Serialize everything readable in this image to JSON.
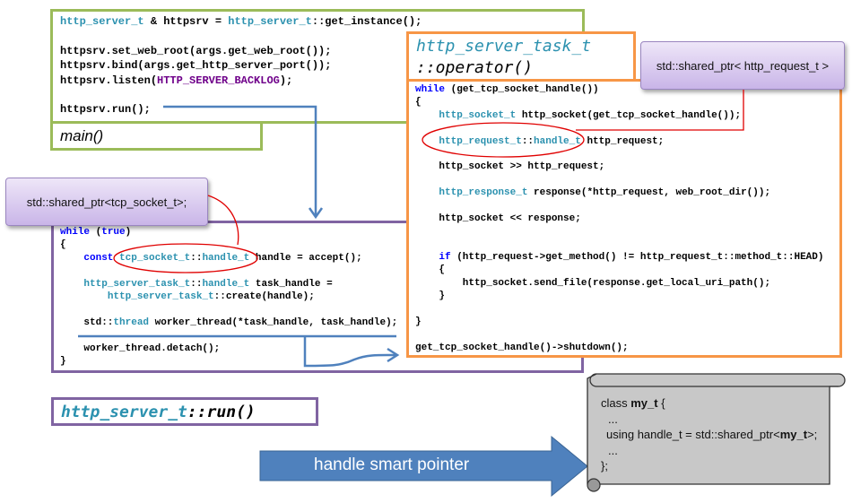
{
  "main_box": {
    "label": "main()",
    "lines": [
      [
        {
          "t": "http_server_t",
          "c": "ty"
        },
        {
          "t": " & httpsrv = "
        },
        {
          "t": "http_server_t",
          "c": "ty"
        },
        {
          "t": "::get_instance();"
        }
      ],
      [],
      [
        {
          "t": "httpsrv.set_web_root(args.get_web_root());"
        }
      ],
      [
        {
          "t": "httpsrv.bind(args.get_http_server_port());"
        }
      ],
      [
        {
          "t": "httpsrv.listen("
        },
        {
          "t": "HTTP_SERVER_BACKLOG",
          "c": "mc"
        },
        {
          "t": ");"
        }
      ],
      [],
      [
        {
          "t": "httpsrv.run();"
        }
      ]
    ]
  },
  "task_box": {
    "title_line1": "http_server_task_t",
    "title_line2": "::operator()",
    "lines": [
      [
        {
          "t": "while",
          "c": "kw"
        },
        {
          "t": " (get_tcp_socket_handle())"
        }
      ],
      [
        {
          "t": "{"
        }
      ],
      [
        {
          "t": "    "
        },
        {
          "t": "http_socket_t",
          "c": "ty"
        },
        {
          "t": " http_socket(get_tcp_socket_handle());"
        }
      ],
      [],
      [
        {
          "t": "    "
        },
        {
          "t": "http_request_t",
          "c": "ty"
        },
        {
          "t": "::"
        },
        {
          "t": "handle_t",
          "c": "ty"
        },
        {
          "t": " http_request;"
        }
      ],
      [],
      [
        {
          "t": "    http_socket >> http_request;"
        }
      ],
      [],
      [
        {
          "t": "    "
        },
        {
          "t": "http_response_t",
          "c": "ty"
        },
        {
          "t": " response(*http_request, web_root_dir());"
        }
      ],
      [],
      [
        {
          "t": "    http_socket << response;"
        }
      ],
      [],
      [],
      [
        {
          "t": "    "
        },
        {
          "t": "if",
          "c": "kw"
        },
        {
          "t": " (http_request->get_method() != http_request_t::method_t::HEAD)"
        }
      ],
      [
        {
          "t": "    {"
        }
      ],
      [
        {
          "t": "        http_socket.send_file(response.get_local_uri_path();"
        }
      ],
      [
        {
          "t": "    }"
        }
      ],
      [],
      [
        {
          "t": "}"
        }
      ],
      [],
      [
        {
          "t": "get_tcp_socket_handle()->shutdown();"
        }
      ]
    ]
  },
  "run_box": {
    "title_part1": "http_server_t",
    "title_part2": "::run()",
    "lines": [
      [
        {
          "t": "while",
          "c": "kw"
        },
        {
          "t": " ("
        },
        {
          "t": "true",
          "c": "kw"
        },
        {
          "t": ")"
        }
      ],
      [
        {
          "t": "{"
        }
      ],
      [
        {
          "t": "    "
        },
        {
          "t": "const",
          "c": "kw"
        },
        {
          "t": " "
        },
        {
          "t": "tcp_socket_t",
          "c": "ty"
        },
        {
          "t": "::"
        },
        {
          "t": "handle_t",
          "c": "ty"
        },
        {
          "t": " handle = accept();"
        }
      ],
      [],
      [
        {
          "t": "    "
        },
        {
          "t": "http_server_task_t",
          "c": "ty"
        },
        {
          "t": "::"
        },
        {
          "t": "handle_t",
          "c": "ty"
        },
        {
          "t": " task_handle ="
        }
      ],
      [
        {
          "t": "        "
        },
        {
          "t": "http_server_task_t",
          "c": "ty"
        },
        {
          "t": "::create(handle);"
        }
      ],
      [],
      [
        {
          "t": "    std::"
        },
        {
          "t": "thread",
          "c": "ty"
        },
        {
          "t": " worker_thread(*task_handle, task_handle);"
        }
      ],
      [],
      [
        {
          "t": "    worker_thread.detach();"
        }
      ],
      [
        {
          "t": "}"
        }
      ]
    ]
  },
  "callouts": {
    "tcp_socket_ptr": "std::shared_ptr<tcp_socket_t>;",
    "http_request_ptr": "std::shared_ptr< http_request_t >"
  },
  "arrow_label": "handle smart pointer",
  "class_scroll": {
    "line1_a": "class ",
    "line1_b": "my_t",
    "line1_c": " {",
    "line2": "...",
    "line3_a": "using handle_t = std::shared_ptr<",
    "line3_b": "my_t",
    "line3_c": ">;",
    "line4": "...",
    "line5": "};"
  },
  "colors": {
    "green": "#9bbb59",
    "orange": "#f79646",
    "purple": "#8064a2",
    "blue": "#4f81bd",
    "red": "#ff0000",
    "keyword": "#0000ff",
    "type": "#2b91af",
    "macro": "#6f008a"
  }
}
